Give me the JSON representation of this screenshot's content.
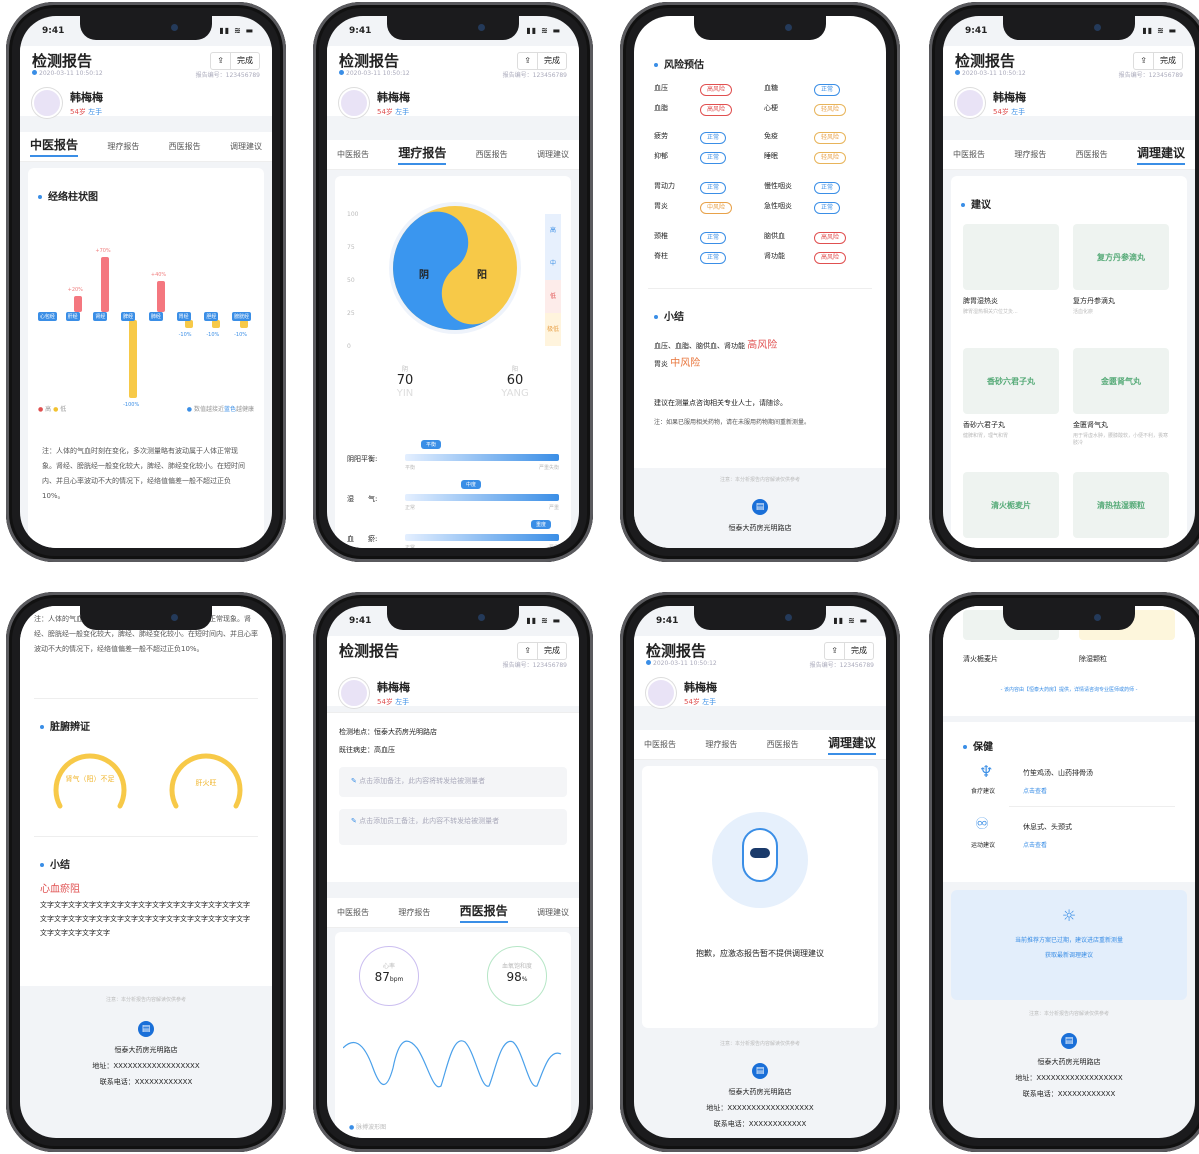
{
  "status": {
    "time": "9:41"
  },
  "header": {
    "title": "检测报告",
    "done": "完成",
    "datetime": "2020-03-11 10:50:12",
    "report_no": "报告编号：123456789"
  },
  "user": {
    "name": "韩梅梅",
    "age": "54岁",
    "hand": "左手"
  },
  "tabs": [
    "中医报告",
    "理疗报告",
    "西医报告",
    "调理建议"
  ],
  "p1": {
    "section": "经络柱状图",
    "meridians": [
      "心包经",
      "肝经",
      "肾经",
      "脾经",
      "肺经",
      "胃经",
      "胆经",
      "膀胱经"
    ],
    "values": [
      0,
      20,
      70,
      -100,
      40,
      -10,
      -10,
      -10
    ],
    "labels": [
      "+20%",
      "+70%",
      "-100%",
      "+40%",
      "-10%",
      "-10%",
      "-10%"
    ],
    "legend_high": "高",
    "legend_low": "低",
    "legend_note": "数值越接近",
    "legend_link": "蓝色",
    "legend_tail": "越健康",
    "note": "注：人体的气血时刻在变化，多次测量略有波动属于人体正常现象。肾经、膀胱经一般变化较大，脾经、肺经变化较小。在短时间内、并且心率波动不大的情况下，经络值偏差一般不超过正负10%。"
  },
  "p2": {
    "yticks": [
      "100",
      "75",
      "50",
      "25",
      "0"
    ],
    "yin": "阴",
    "yang": "阳",
    "legend": [
      "高",
      "中",
      "低",
      "极低"
    ],
    "yin_value": "70",
    "yang_value": "60",
    "yin_en": "YIN",
    "yang_en": "YANG",
    "rows": [
      {
        "label": "阴阳平衡:",
        "tag": "平衡",
        "left": "平衡",
        "right": "严重失衡"
      },
      {
        "label": "湿　　气:",
        "tag": "中度",
        "left": "正常",
        "right": "严重"
      },
      {
        "label": "血　　瘀:",
        "tag": "重度",
        "left": "正常",
        "right": "严重"
      }
    ]
  },
  "p3": {
    "section": "风险预估",
    "risks": [
      [
        "血压",
        "高风险",
        "血糖",
        "正常"
      ],
      [
        "血脂",
        "高风险",
        "心梗",
        "轻风险"
      ],
      [
        "疲劳",
        "正常",
        "免疫",
        "轻风险"
      ],
      [
        "抑郁",
        "正常",
        "睡眠",
        "轻风险"
      ],
      [
        "胃动力",
        "正常",
        "慢性咽炎",
        "正常"
      ],
      [
        "胃炎",
        "中风险",
        "急性咽炎",
        "正常"
      ],
      [
        "颈椎",
        "正常",
        "脑供血",
        "高风险"
      ],
      [
        "脊柱",
        "正常",
        "肾功能",
        "高风险"
      ]
    ],
    "summary_title": "小结",
    "summary_1": "血压、血脂、脑供血、肾功能",
    "summary_1_level": "高风险",
    "summary_2": "胃炎",
    "summary_2_level": "中风险",
    "advice": "建议在测量点咨询相关专业人士，请随诊。",
    "advice_note": "注：如果已服用相关药物，请在未服用药物期间重新测量。",
    "disclaimer": "注意：本分析报告内容解读仅供参考",
    "store": "恒泰大药房光明路店"
  },
  "p4": {
    "section": "建议",
    "products": [
      {
        "name": "脾胃湿热炎",
        "sub": "脾胃湿热相关穴位艾灸..."
      },
      {
        "name": "复方丹参滴丸",
        "sub": "活血化瘀",
        "img": "复方丹参滴丸"
      },
      {
        "name": "香砂六君子丸",
        "sub": "健脾和胃，理气和胃",
        "img": "香砂六君子丸"
      },
      {
        "name": "金匮肾气丸",
        "sub": "用于肾虚水肿，腰膝酸软，小便不利，畏寒肢冷",
        "img": "金匮肾气丸"
      },
      {
        "name": "",
        "sub": "",
        "img": "清火栀麦片"
      },
      {
        "name": "",
        "sub": "",
        "img": "清热祛湿颗粒"
      }
    ]
  },
  "p5": {
    "note_top": "注：人体的气血时刻在变化，多次测量略有波动属于人体正常现象。肾经、膀胱经一般变化较大，脾经、肺经变化较小。在短时间内、并且心率波动不大的情况下，经络值偏差一般不超过正负10%。",
    "section": "脏腑辨证",
    "gauge1": "肾气（阳）不足",
    "gauge2": "肝火旺",
    "summary_title": "小结",
    "diagnosis": "心血瘀阻",
    "body": "文字文字文字文字文字文字文字文字文字文字文字文字文字文字文字文字文字文字文字文字文字文字文字文字文字文字文字文字文字文字文字文字文字文字文字",
    "disclaimer": "注意：本分析报告内容解读仅供参考",
    "store": "恒泰大药房光明路店",
    "address": "地址：XXXXXXXXXXXXXXXXXX",
    "phone": "联系电话：XXXXXXXXXXXX"
  },
  "p6": {
    "location": "检测地点：恒泰大药房光明路店",
    "history": "既往病史：高血压",
    "note1": "点击添加备注，此内容将转发给被测量者",
    "note2": "点击添加员工备注，此内容不转发给被测量者",
    "hr_label": "心率",
    "hr_value": "87",
    "hr_unit": "bpm",
    "spo2_label": "血氧饱和度",
    "spo2_value": "98",
    "spo2_unit": "%",
    "wave_legend": "脉搏波形图"
  },
  "p7": {
    "empty": "抱歉，应激态报告暂不提供调理建议",
    "disclaimer": "注意：本分析报告内容解读仅供参考",
    "store": "恒泰大药房光明路店",
    "address": "地址：XXXXXXXXXXXXXXXXXX",
    "phone": "联系电话：XXXXXXXXXXXX"
  },
  "p8": {
    "top1": "清火栀麦片",
    "top2": "除湿颗粒",
    "provider": "- 该内容由【恒泰大药房】提供，详情请咨询专业医师或药师 -",
    "section": "保健",
    "diet_label": "食疗建议",
    "diet_text": "竹笙鸡汤、山药排骨汤",
    "diet_link": "点击查看",
    "sport_label": "运动建议",
    "sport_text": "休息式、头颈式",
    "sport_link": "点击查看",
    "expired": "当前推荐方案已过期，建议进店重新测量",
    "refresh": "获取最新调理建议",
    "disclaimer": "注意：本分析报告内容解读仅供参考",
    "store": "恒泰大药房光明路店",
    "address": "地址：XXXXXXXXXXXXXXXXXX",
    "phone": "联系电话：XXXXXXXXXXXX"
  }
}
